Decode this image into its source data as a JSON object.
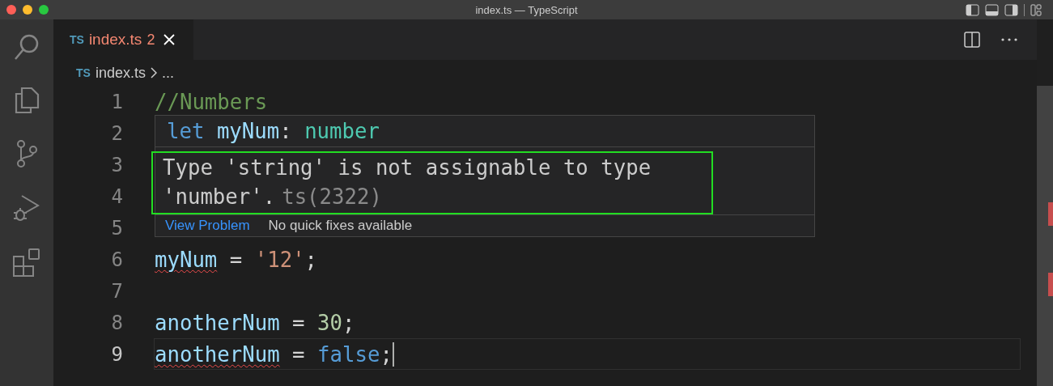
{
  "window": {
    "title": "index.ts — TypeScript"
  },
  "tabs": [
    {
      "icon_text": "TS",
      "label": "index.ts",
      "badge": "2",
      "selected": true,
      "error": true
    }
  ],
  "breadcrumb": {
    "icon_text": "TS",
    "file": "index.ts",
    "rest": "..."
  },
  "code_lines": [
    {
      "number": "1",
      "current": false,
      "tokens": [
        {
          "text": "//Numbers",
          "kind": "comment"
        }
      ]
    },
    {
      "number": "2",
      "current": false
    },
    {
      "number": "3",
      "current": false
    },
    {
      "number": "4",
      "current": false
    },
    {
      "number": "5",
      "current": false
    },
    {
      "number": "6",
      "current": false,
      "tokens": [
        {
          "text": "myNum",
          "kind": "variable",
          "error": true
        },
        {
          "text": " = ",
          "kind": "operator"
        },
        {
          "text": "'12'",
          "kind": "string"
        },
        {
          "text": ";",
          "kind": "punct"
        }
      ]
    },
    {
      "number": "7",
      "current": false
    },
    {
      "number": "8",
      "current": false,
      "tokens": [
        {
          "text": "anotherNum",
          "kind": "variable"
        },
        {
          "text": " = ",
          "kind": "operator"
        },
        {
          "text": "30",
          "kind": "number"
        },
        {
          "text": ";",
          "kind": "punct"
        }
      ]
    },
    {
      "number": "9",
      "current": true,
      "tokens": [
        {
          "text": "anotherNum",
          "kind": "variable",
          "error": true
        },
        {
          "text": " = ",
          "kind": "operator"
        },
        {
          "text": "false",
          "kind": "keyword"
        },
        {
          "text": ";",
          "kind": "punct"
        }
      ]
    }
  ],
  "hover": {
    "signature": [
      {
        "text": "let ",
        "kind": "keyword"
      },
      {
        "text": "myNum",
        "kind": "variable"
      },
      {
        "text": ": ",
        "kind": "punct"
      },
      {
        "text": "number",
        "kind": "type"
      }
    ],
    "message_line_1": "Type 'string' is not assignable to type",
    "message_line_2": "'number'.",
    "error_code": "ts(2322)",
    "highlighted": true,
    "actions": [
      {
        "label": "View Problem",
        "kind": "link"
      },
      {
        "label": "No quick fixes available",
        "kind": "text"
      }
    ]
  }
}
